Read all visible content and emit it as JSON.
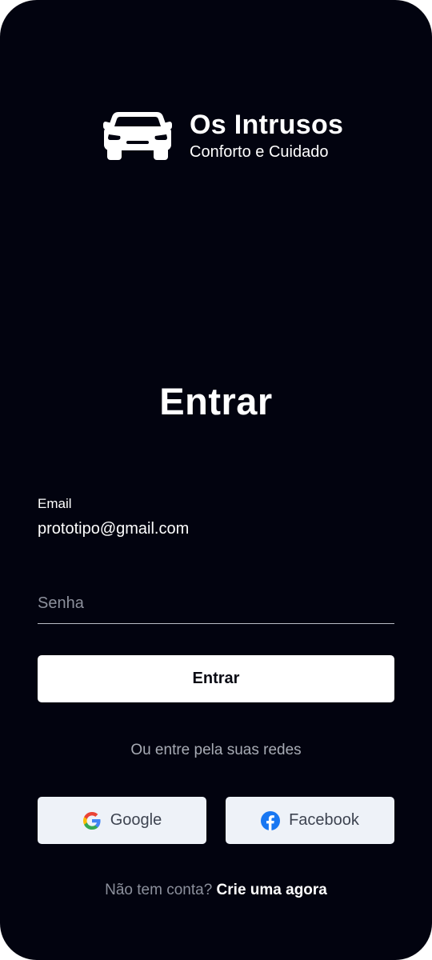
{
  "brand": {
    "title": "Os Intrusos",
    "subtitle": "Conforto e Cuidado",
    "icon": "car-icon"
  },
  "page_title": "Entrar",
  "email": {
    "label": "Email",
    "value": "prototipo@gmail.com"
  },
  "password": {
    "placeholder": "Senha"
  },
  "primary_button": {
    "label": "Entrar"
  },
  "social": {
    "caption": "Ou entre pela suas redes",
    "google_label": "Google",
    "google_icon": "google-icon",
    "facebook_label": "Facebook",
    "facebook_icon": "facebook-icon"
  },
  "footer": {
    "question": "Não tem conta?",
    "link": "Crie uma agora"
  },
  "colors": {
    "background": "#02030f",
    "primary_button_bg": "#ffffff",
    "social_button_bg": "#eef2f8",
    "muted_text": "#8c909c",
    "facebook_blue": "#1877f2"
  }
}
